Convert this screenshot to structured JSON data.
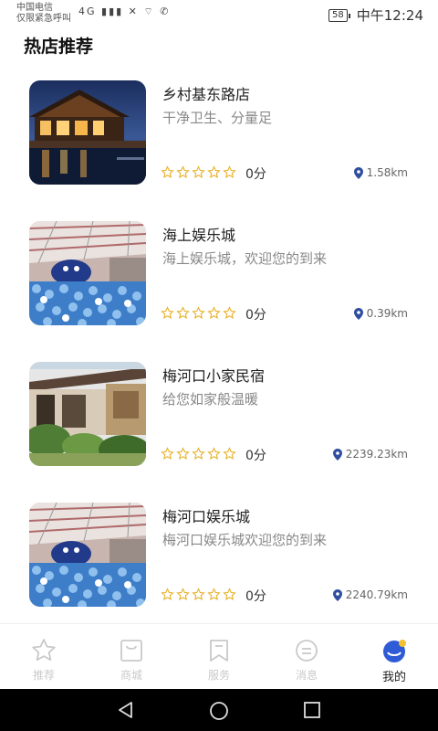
{
  "status_bar": {
    "carrier_line1": "中国电信",
    "carrier_line2": "仅限紧急呼叫",
    "icons": "4G  ▮▮▮ ✕ ⌔ ✆",
    "battery": "58",
    "time": "中午12:24"
  },
  "section_title": "热店推荐",
  "shops": [
    {
      "name": "乡村基东路店",
      "desc": "干净卫生、分量足",
      "score": "0分",
      "distance": "1.58km",
      "rating": 0,
      "image": "resort-at-night"
    },
    {
      "name": "海上娱乐城",
      "desc": "海上娱乐城，欢迎您的到来",
      "score": "0分",
      "distance": "0.39km",
      "rating": 0,
      "image": "ball-pit-playground"
    },
    {
      "name": "梅河口小家民宿",
      "desc": "给您如家般温暖",
      "score": "0分",
      "distance": "2239.23km",
      "rating": 0,
      "image": "house-with-garden"
    },
    {
      "name": "梅河口娱乐城",
      "desc": "梅河口娱乐城欢迎您的到来",
      "score": "0分",
      "distance": "2240.79km",
      "rating": 0,
      "image": "ball-pit-playground"
    }
  ],
  "tabs": [
    {
      "label": "推荐",
      "icon": "star-icon"
    },
    {
      "label": "商城",
      "icon": "shopping-bag-icon"
    },
    {
      "label": "服务",
      "icon": "bookmark-icon"
    },
    {
      "label": "消息",
      "icon": "message-icon"
    },
    {
      "label": "我的",
      "icon": "profile-icon",
      "active": true
    }
  ],
  "colors": {
    "star": "#e7b22a",
    "pin": "#2f4ea0",
    "tab_inactive": "#c9c9c9",
    "tab_active_icon": "#2f5bd6",
    "badge": "#f2c230"
  }
}
